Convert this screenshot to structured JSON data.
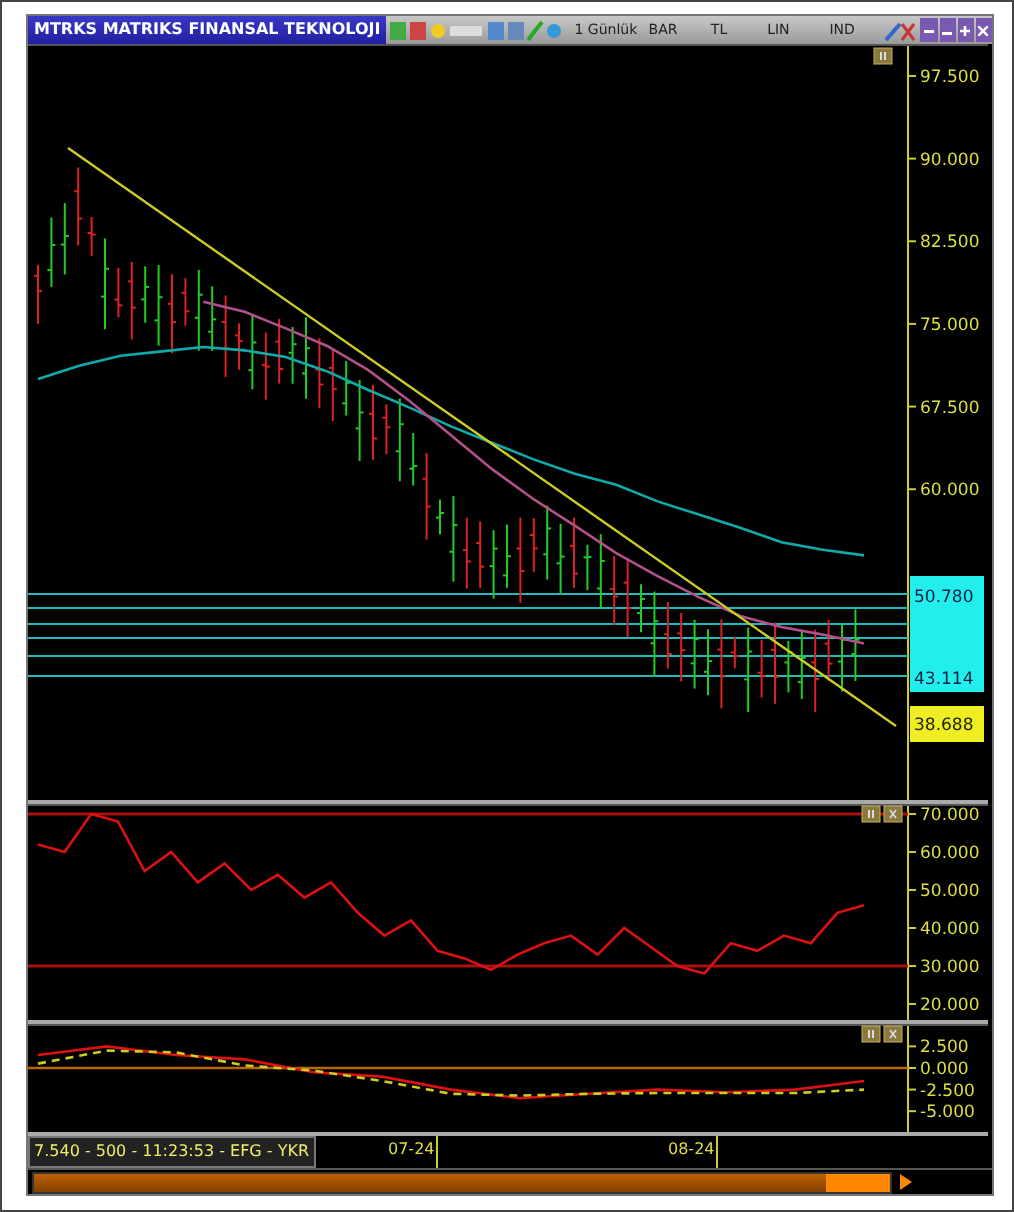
{
  "window": {
    "title": "MTRKS MATRIKS FINANSAL TEKNOLOJI"
  },
  "toolbar": {
    "period": "1 Günlük",
    "items": [
      "BAR",
      "TL",
      "LIN",
      "IND"
    ]
  },
  "price_pane": {
    "levels": [
      "50.780",
      "43.114"
    ],
    "last": "38.688",
    "chart_data": {
      "type": "line",
      "categories": [
        null,
        null,
        null,
        null,
        null,
        null,
        null,
        null,
        null,
        null,
        null,
        null,
        null,
        null,
        null,
        null,
        null,
        null,
        null,
        null,
        null
      ],
      "ylim": [
        31.8,
        100.4
      ],
      "yticks": [
        {
          "value": 97.5,
          "label": "97.500"
        },
        {
          "value": 90,
          "label": "90.000"
        },
        {
          "value": 82.5,
          "label": "82.500"
        },
        {
          "value": 75,
          "label": "75.000"
        },
        {
          "value": 67.5,
          "label": "67.500"
        },
        {
          "value": 60,
          "label": "60.000"
        }
      ],
      "series": [
        {
          "color": "#11aaaa",
          "values": [
            70,
            71.2,
            72.1,
            72.5,
            72.9,
            72.6,
            72,
            70.7,
            69,
            67.4,
            65.7,
            64.2,
            62.7,
            61.4,
            60.4,
            58.9,
            57.7,
            56.5,
            55.2,
            54.5,
            54
          ]
        },
        {
          "color": "#b2508a",
          "values": [
            null,
            null,
            null,
            null,
            77,
            76.1,
            74.6,
            73,
            70.8,
            68,
            64.9,
            61.8,
            59.1,
            56.7,
            54.2,
            52.1,
            50.2,
            48.5,
            47.5,
            46.8,
            46
          ]
        }
      ]
    }
  },
  "rsi_pane": {
    "chart_data": {
      "type": "line",
      "categories": [
        null,
        null,
        null,
        null,
        null,
        null,
        null,
        null,
        null,
        null,
        null,
        null,
        null,
        null,
        null,
        null,
        null,
        null,
        null,
        null,
        null,
        null,
        null,
        null,
        null,
        null,
        null,
        null,
        null,
        null,
        null,
        null
      ],
      "ylim": [
        15.79,
        72.63
      ],
      "yticks": [
        {
          "value": 70,
          "label": "70.000"
        },
        {
          "value": 60,
          "label": "60.000"
        },
        {
          "value": 50,
          "label": "50.000"
        },
        {
          "value": 40,
          "label": "40.000"
        },
        {
          "value": 30,
          "label": "30.000"
        },
        {
          "value": 20,
          "label": "20.000"
        }
      ],
      "series": [
        {
          "color": "#dd1111",
          "values": [
            62,
            60,
            70,
            68,
            55,
            60,
            52,
            57,
            50,
            54,
            48,
            52,
            44,
            38,
            42,
            34,
            32,
            29,
            33,
            36,
            38,
            33,
            40,
            35,
            30,
            28,
            36,
            34,
            38,
            36,
            44,
            46
          ]
        }
      ]
    }
  },
  "macd_pane": {
    "chart_data": {
      "type": "line",
      "categories": [
        null,
        null,
        null,
        null,
        null,
        null,
        null,
        null,
        null,
        null,
        null,
        null,
        null
      ],
      "ylim": [
        -7.41,
        5.09
      ],
      "yticks": [
        {
          "value": 2.5,
          "label": "2.500"
        },
        {
          "value": 0,
          "label": "0.000"
        },
        {
          "value": -2.5,
          "label": "-2.500"
        },
        {
          "value": -5,
          "label": "-5.000"
        }
      ],
      "series": [
        {
          "color": "#dd1111",
          "values": [
            1.5,
            2.5,
            1.5,
            1,
            -0.5,
            -1,
            -2.5,
            -3.5,
            -3,
            -2.5,
            -2.8,
            -2.5,
            -1.5
          ]
        },
        {
          "color": "#cccc22",
          "line_style": "dashed",
          "values": [
            0.5,
            2,
            1.8,
            0.3,
            -0.3,
            -1.5,
            -3,
            -3.2,
            -3,
            -2.9,
            -2.9,
            -2.9,
            -2.5
          ]
        }
      ]
    }
  },
  "status": "7.540 - 500 - 11:23:53 - EFG - YKR",
  "dates": [
    "07-24",
    "08-24"
  ]
}
